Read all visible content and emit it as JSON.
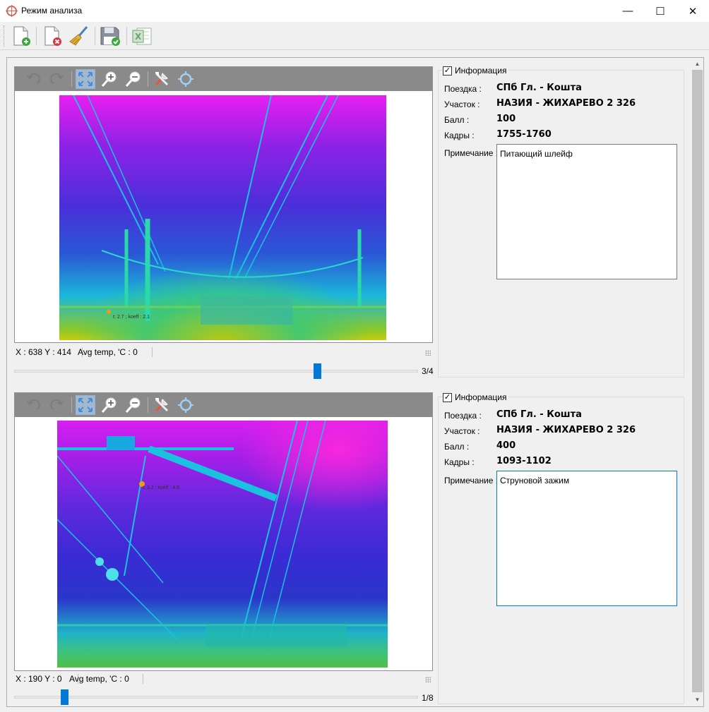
{
  "window": {
    "title": "Режим анализа",
    "minimize": "—",
    "maximize": "☐",
    "close": "✕"
  },
  "toolbar": {
    "buttons": [
      {
        "name": "new-document-button",
        "icon": "document-add-icon"
      },
      {
        "name": "delete-document-button",
        "icon": "document-delete-icon"
      },
      {
        "name": "clear-button",
        "icon": "broom-icon"
      },
      {
        "name": "save-button",
        "icon": "floppy-save-icon"
      },
      {
        "name": "export-excel-button",
        "icon": "excel-icon"
      }
    ]
  },
  "colors": {
    "accent": "#0078d7",
    "thermal_hot": "#ff1fe0",
    "thermal_mid": "#3a2bd8",
    "thermal_cold": "#16c9d8",
    "thermal_ground": "#b5c514"
  },
  "panels": [
    {
      "image_toolbar": [
        "undo-icon",
        "redo-icon",
        "fit-screen-icon",
        "zoom-in-icon",
        "zoom-out-icon",
        "tools-icon",
        "target-icon"
      ],
      "marker_label": "t: 2.7 ; koeff : 2.1",
      "status": {
        "coords": "X : 638 Y : 414",
        "avg_temp": "Avg temp, 'C : 0"
      },
      "slider": {
        "position": 0.75,
        "value": "3/4"
      },
      "info": {
        "legend": "Информация",
        "checked": true,
        "trip_label": "Поездка :",
        "trip": "СПб Гл. - Кошта",
        "section_label": "Участок :",
        "section": "НАЗИЯ - ЖИХАРЕВО 2 326",
        "score_label": "Балл :",
        "score": "100",
        "frames_label": "Кадры :",
        "frames": "1755-1760",
        "note_label": "Примечание :",
        "note": "Питающий шлейф"
      }
    },
    {
      "image_toolbar": [
        "undo-icon",
        "redo-icon",
        "fit-screen-icon",
        "zoom-in-icon",
        "zoom-out-icon",
        "tools-icon",
        "target-icon"
      ],
      "marker_label": "t: 3.2 ; koeff : 4.5",
      "status": {
        "coords": "X : 190 Y : 0",
        "avg_temp": "Avg temp, 'C : 0"
      },
      "slider": {
        "position": 0.125,
        "value": "1/8"
      },
      "info": {
        "legend": "Информация",
        "checked": true,
        "trip_label": "Поездка :",
        "trip": "СПб Гл. - Кошта",
        "section_label": "Участок :",
        "section": "НАЗИЯ - ЖИХАРЕВО 2 326",
        "score_label": "Балл :",
        "score": "400",
        "frames_label": "Кадры :",
        "frames": "1093-1102",
        "note_label": "Примечание :",
        "note": "Струновой зажим"
      }
    }
  ]
}
